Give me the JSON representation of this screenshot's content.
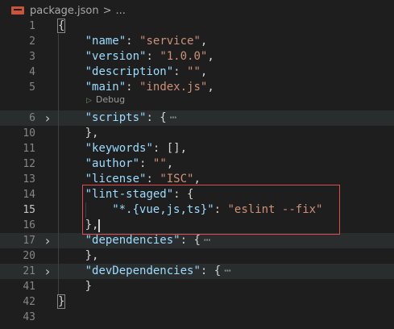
{
  "breadcrumb": {
    "file": "package.json",
    "separator": ">",
    "ellipsis": "..."
  },
  "editor": {
    "debug_label": "Debug",
    "lines": [
      {
        "n": "1",
        "parts": [
          [
            "p",
            "{"
          ]
        ]
      },
      {
        "n": "2",
        "parts": [
          [
            "k",
            "\"name\""
          ],
          [
            "p",
            ": "
          ],
          [
            "s",
            "\"service\""
          ],
          [
            "p",
            ","
          ]
        ]
      },
      {
        "n": "3",
        "parts": [
          [
            "k",
            "\"version\""
          ],
          [
            "p",
            ": "
          ],
          [
            "s",
            "\"1.0.0\""
          ],
          [
            "p",
            ","
          ]
        ]
      },
      {
        "n": "4",
        "parts": [
          [
            "k",
            "\"description\""
          ],
          [
            "p",
            ": "
          ],
          [
            "s",
            "\"\""
          ],
          [
            "p",
            ","
          ]
        ]
      },
      {
        "n": "5",
        "parts": [
          [
            "k",
            "\"main\""
          ],
          [
            "p",
            ": "
          ],
          [
            "s",
            "\"index.js\""
          ],
          [
            "p",
            ","
          ]
        ]
      },
      {
        "n": "6",
        "parts": [
          [
            "k",
            "\"scripts\""
          ],
          [
            "p",
            ": {"
          ]
        ],
        "folded": true
      },
      {
        "n": "10",
        "parts": [
          [
            "p",
            "},"
          ]
        ]
      },
      {
        "n": "11",
        "parts": [
          [
            "k",
            "\"keywords\""
          ],
          [
            "p",
            ": [],"
          ]
        ]
      },
      {
        "n": "12",
        "parts": [
          [
            "k",
            "\"author\""
          ],
          [
            "p",
            ": "
          ],
          [
            "s",
            "\"\""
          ],
          [
            "p",
            ","
          ]
        ]
      },
      {
        "n": "13",
        "parts": [
          [
            "k",
            "\"license\""
          ],
          [
            "p",
            ": "
          ],
          [
            "s",
            "\"ISC\""
          ],
          [
            "p",
            ","
          ]
        ]
      },
      {
        "n": "14",
        "parts": [
          [
            "k",
            "\"lint-staged\""
          ],
          [
            "p",
            ": {"
          ]
        ]
      },
      {
        "n": "15",
        "parts": [
          [
            "k",
            "\"*.{vue,js,ts}\""
          ],
          [
            "p",
            ": "
          ],
          [
            "s",
            "\"eslint --fix\""
          ]
        ]
      },
      {
        "n": "16",
        "parts": [
          [
            "p",
            "},"
          ]
        ]
      },
      {
        "n": "17",
        "parts": [
          [
            "k",
            "\"dependencies\""
          ],
          [
            "p",
            ": {"
          ]
        ],
        "folded": true
      },
      {
        "n": "20",
        "parts": [
          [
            "p",
            "},"
          ]
        ]
      },
      {
        "n": "21",
        "parts": [
          [
            "k",
            "\"devDependencies\""
          ],
          [
            "p",
            ": {"
          ]
        ],
        "folded": true
      },
      {
        "n": "41",
        "parts": [
          [
            "p",
            "}"
          ]
        ]
      },
      {
        "n": "42",
        "parts": [
          [
            "p",
            "}"
          ]
        ]
      },
      {
        "n": "43",
        "parts": []
      }
    ],
    "fold_ellipsis": "⋯"
  },
  "colors": {
    "background": "#1e1e1e",
    "key": "#9cdcfe",
    "string": "#ce9178",
    "punctuation": "#d4d4d4",
    "line_number": "#858585",
    "highlight_box": "#e04a4a"
  }
}
